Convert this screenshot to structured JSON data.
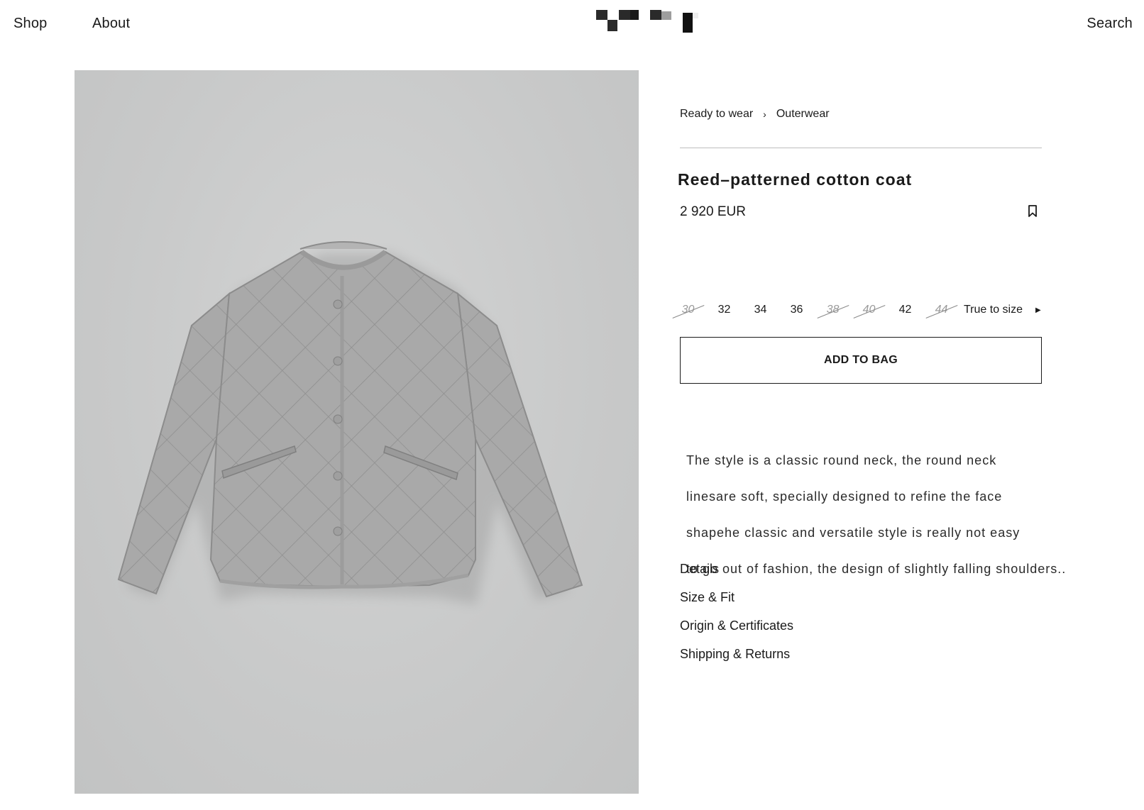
{
  "header": {
    "nav_left": [
      {
        "label": "Shop"
      },
      {
        "label": "About"
      }
    ],
    "nav_right": {
      "label": "Search"
    },
    "logo_icon": "pixelated-logo"
  },
  "product_image": {
    "icon": "quilted-jacket-photo",
    "background_color": "#c8c9c9"
  },
  "breadcrumb": {
    "items": [
      "Ready to wear",
      "Outerwear"
    ],
    "separator": "›"
  },
  "product": {
    "title": "Reed–patterned cotton coat",
    "price": "2 920 EUR",
    "save_icon": "bookmark-icon"
  },
  "sizes": {
    "options": [
      {
        "label": "30",
        "available": false
      },
      {
        "label": "32",
        "available": true
      },
      {
        "label": "34",
        "available": true
      },
      {
        "label": "36",
        "available": true
      },
      {
        "label": "38",
        "available": false
      },
      {
        "label": "40",
        "available": false
      },
      {
        "label": "42",
        "available": true
      },
      {
        "label": "44",
        "available": false
      }
    ],
    "fit_note": "True to size",
    "fit_icon": "play-arrow-icon"
  },
  "add_to_bag": {
    "label": "ADD TO BAG"
  },
  "description": {
    "lines": [
      "The style is a classic round neck, the round neck",
      "linesare soft, specially designed to refine the face",
      "shapehe classic and versatile style is really not easy",
      "to go out of fashion, the design of slightly falling shoulders.."
    ]
  },
  "accordion": {
    "items": [
      "Details",
      "Size & Fit",
      "Origin & Certificates",
      "Shipping & Returns"
    ]
  },
  "colors": {
    "text": "#1a1a1a",
    "unavailable": "#9a9a9a",
    "divider": "#bdbdbd",
    "jacket": "#a6a6a6"
  }
}
